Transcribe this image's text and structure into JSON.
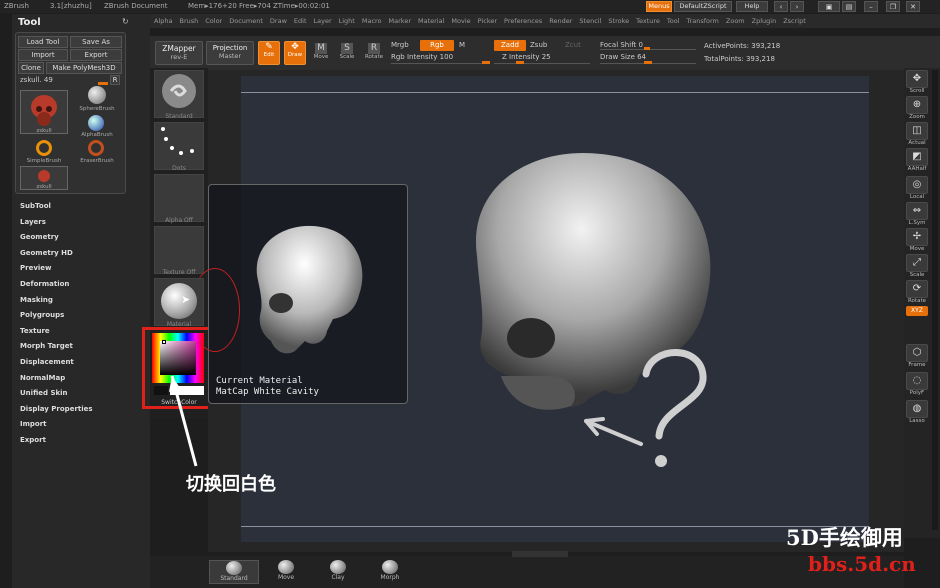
{
  "titlebar": {
    "app": "ZBrush",
    "version": "3.1[zhuzhu]",
    "doc": "ZBrush Document",
    "mem": "Mem▸176+20 Free▸704 ZTime▸00:02:01",
    "menus_btn": "Menus",
    "script_btn": "DefaultZScript",
    "help_btn": "Help"
  },
  "menubar": [
    "Alpha",
    "Brush",
    "Color",
    "Document",
    "Draw",
    "Edit",
    "Layer",
    "Light",
    "Macro",
    "Marker",
    "Material",
    "Movie",
    "Picker",
    "Preferences",
    "Render",
    "Stencil",
    "Stroke",
    "Texture",
    "Tool",
    "Transform",
    "Zoom",
    "Zplugin",
    "Zscript"
  ],
  "tool_panel": {
    "title": "Tool",
    "load_tool": "Load Tool",
    "save_as": "Save As",
    "import": "Import",
    "export": "Export",
    "clone": "Clone",
    "make_polymesh": "Make PolyMesh3D",
    "current_tool": "zskull. 49",
    "r_btn": "R",
    "thumbs": [
      {
        "label": "zskull"
      },
      {
        "label": "SphereBrush"
      },
      {
        "label": "AlphaBrush"
      },
      {
        "label": "SimpleBrush"
      },
      {
        "label": "EraserBrush"
      },
      {
        "label": "zskull"
      }
    ]
  },
  "tool_menu": [
    "SubTool",
    "Layers",
    "Geometry",
    "Geometry HD",
    "Preview",
    "Deformation",
    "Masking",
    "Polygroups",
    "Texture",
    "Morph Target",
    "Displacement",
    "NormalMap",
    "Unified Skin",
    "Display Properties",
    "Import",
    "Export"
  ],
  "toolbar": {
    "zmapper": "ZMapper",
    "zmapper_sub": "rev-E",
    "projection": "Projection",
    "projection_sub": "Master",
    "edit": "Edit",
    "draw": "Draw",
    "move": "Move",
    "scale": "Scale",
    "rotate": "Rotate",
    "mrgb": "Mrgb",
    "rgb": "Rgb",
    "m": "M",
    "rgb_intensity": "Rgb Intensity 100",
    "zadd": "Zadd",
    "zsub": "Zsub",
    "zcut": "Zcut",
    "z_intensity": "Z Intensity 25",
    "focal_shift": "Focal Shift 0",
    "draw_size": "Draw Size 64",
    "active_points": "ActivePoints: 393,218",
    "total_points": "TotalPoints: 393,218"
  },
  "left_shelf": {
    "standard": "Standard",
    "dots": "Dots",
    "alpha": "Alpha Off",
    "texture": "Texture Off",
    "material": "Material",
    "switch_color": "SwitchColor"
  },
  "popup": {
    "title": "Current Material",
    "subtitle": "MatCap White Cavity"
  },
  "right_shelf": [
    "Scroll",
    "Zoom",
    "Actual",
    "AAHalf",
    "Local",
    "L.Sym",
    "Move",
    "Scale",
    "Rotate",
    "XYZ",
    "Frame",
    "PolyF",
    "Lasso"
  ],
  "bottom_shelf": [
    "Standard",
    "Move",
    "Clay",
    "Morph"
  ],
  "annotation": "切换回白色",
  "watermark": {
    "line1": "5D手绘御用",
    "line2": "bbs.5d.cn"
  },
  "colors": {
    "accent_orange": "#e8700a",
    "highlight_red": "#e0201a"
  }
}
